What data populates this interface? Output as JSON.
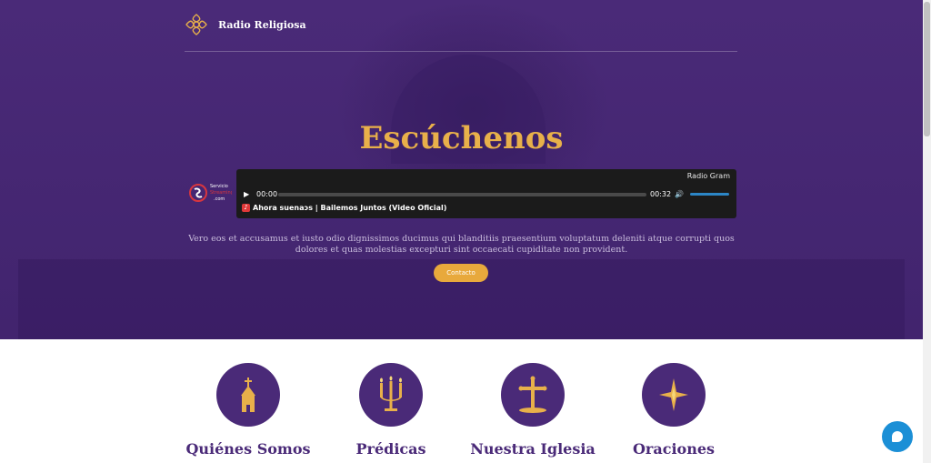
{
  "header": {
    "brand": "Radio Religiosa"
  },
  "hero": {
    "title": "Escúchenos",
    "paragraph": "Vero eos et accusamus et iusto odio dignissimos ducimus qui blanditiis praesentium voluptatum deleniti atque corrupti quos dolores et quas molestias excepturi sint occaecati cupiditate non provident.",
    "contact_label": "Contacto"
  },
  "player": {
    "station": "Radio Gram",
    "current_time": "00:00",
    "duration": "00:32",
    "now_playing": "Ahora suenaɔs | Bailemos Juntos (Video Oficial)",
    "progress": 0,
    "volume": 1.0
  },
  "logo_partner": {
    "text": "Servicio Streaming .com"
  },
  "features": [
    {
      "label": "Quiénes Somos",
      "icon": "church-icon"
    },
    {
      "label": "Prédicas",
      "icon": "candelabrum-icon"
    },
    {
      "label": "Nuestra Iglesia",
      "icon": "cross-icon"
    },
    {
      "label": "Oraciones",
      "icon": "star-icon"
    }
  ],
  "colors": {
    "primary": "#4a2a78",
    "accent": "#e8b04a",
    "button": "#e8a93c",
    "chat": "#1b8fd6"
  }
}
